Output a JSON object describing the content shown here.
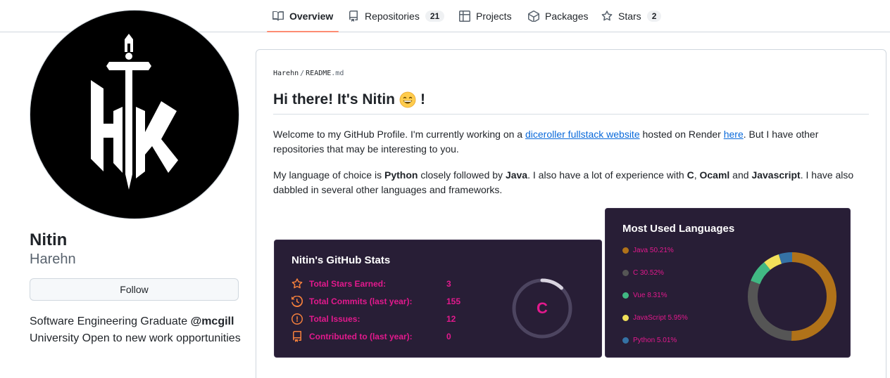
{
  "nav": {
    "tabs": [
      {
        "label": "Overview",
        "icon": "book-icon"
      },
      {
        "label": "Repositories",
        "count": "21",
        "icon": "repo-icon"
      },
      {
        "label": "Projects",
        "icon": "table-icon"
      },
      {
        "label": "Packages",
        "icon": "package-icon"
      },
      {
        "label": "Stars",
        "count": "2",
        "icon": "star-icon"
      }
    ]
  },
  "profile": {
    "name": "Nitin",
    "login": "Harehn",
    "follow_label": "Follow",
    "bio_part1": "Software Engineering Graduate ",
    "bio_mention": "@mcgill",
    "bio_part2": " University Open to new work opportunities"
  },
  "readme": {
    "crumb_user": "Harehn",
    "crumb_sep": "/",
    "crumb_file": "README",
    "crumb_ext": ".md",
    "heading_pre": "Hi there! It's Nitin",
    "heading_post": "!",
    "p1_a": "Welcome to my GitHub Profile. I'm currently working on a ",
    "p1_link1": "diceroller fullstack website",
    "p1_b": " hosted on Render ",
    "p1_link2": "here",
    "p1_c": ". But I have other repositories that may be interesting to you.",
    "p2_a": "My language of choice is ",
    "p2_python": "Python",
    "p2_b": " closely followed by ",
    "p2_java": "Java",
    "p2_c": ". I also have a lot of experience with ",
    "p2_c_lang": "C",
    "p2_d": ", ",
    "p2_ocaml": "Ocaml",
    "p2_e": " and ",
    "p2_js": "Javascript",
    "p2_f": ". I have also dabbled in several other languages and frameworks."
  },
  "stats_card": {
    "title": "Nitin's GitHub Stats",
    "rows": [
      {
        "label": "Total Stars Earned:",
        "value": "3",
        "icon": "star-icon"
      },
      {
        "label": "Total Commits (last year):",
        "value": "155",
        "icon": "history-icon"
      },
      {
        "label": "Total Issues:",
        "value": "12",
        "icon": "issue-icon"
      },
      {
        "label": "Contributed to (last year):",
        "value": "0",
        "icon": "repo-icon"
      }
    ],
    "rank": "C",
    "rank_progress": 0.12,
    "accent": "#e2198d",
    "icon_color": "#f47f3c",
    "background": "#281e36"
  },
  "lang_card": {
    "title": "Most Used Languages",
    "languages": [
      {
        "label": "Java 50.21%",
        "percent": 50.21,
        "color": "#b07219"
      },
      {
        "label": "C 30.52%",
        "percent": 30.52,
        "color": "#555555"
      },
      {
        "label": "Vue 8.31%",
        "percent": 8.31,
        "color": "#41b883"
      },
      {
        "label": "JavaScript 5.95%",
        "percent": 5.95,
        "color": "#f1e05a"
      },
      {
        "label": "Python 5.01%",
        "percent": 5.01,
        "color": "#3572a5"
      }
    ]
  }
}
